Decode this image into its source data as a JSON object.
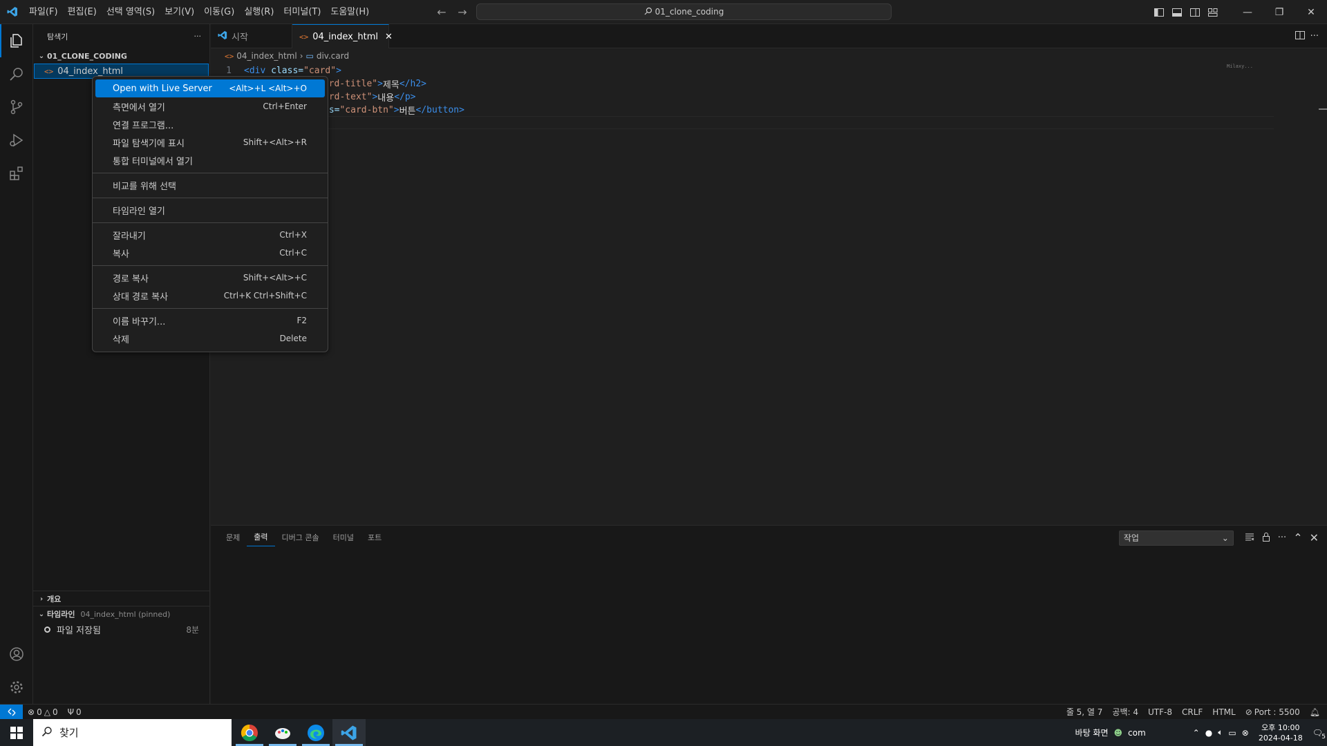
{
  "titlebar": {
    "menus": [
      "파일(F)",
      "편집(E)",
      "선택 영역(S)",
      "보기(V)",
      "이동(G)",
      "실행(R)",
      "터미널(T)",
      "도움말(H)"
    ],
    "search_text": "01_clone_coding"
  },
  "sidebar": {
    "header": "탐색기",
    "more": "···",
    "folder": "01_CLONE_CODING",
    "file": "04_index_html",
    "outline_title": "개요",
    "timeline_title": "타임라인",
    "timeline_sub": "04_index_html (pinned)",
    "timeline_entry": "파일 저장됨",
    "timeline_age": "8분"
  },
  "tabs": [
    {
      "label": "시작",
      "active": false
    },
    {
      "label": "04_index_html",
      "active": true
    }
  ],
  "breadcrumb": {
    "file": "04_index_html",
    "symbol": "div.card"
  },
  "editor": {
    "line1_num": "1",
    "line1": {
      "open": "<div",
      "attr": " class=",
      "str": "\"card\"",
      "close": ">"
    },
    "line2": {
      "str": "card-title\"",
      "close": ">",
      "txt": "제목",
      "end": "</h2>"
    },
    "line3": {
      "str": "ard-text\"",
      "close": ">",
      "txt": "내용",
      "end": "</p>"
    },
    "line4": {
      "attr": "ss=",
      "str": "\"card-btn\"",
      "close": ">",
      "txt": "버튼",
      "end": "</button>"
    },
    "minimap_text": "Milaxy..."
  },
  "context_menu": {
    "items": [
      {
        "label": "Open with Live Server",
        "kb": "<Alt>+L <Alt>+O",
        "highlight": true
      },
      {
        "label": "측면에서 열기",
        "kb": "Ctrl+Enter"
      },
      {
        "label": "연결 프로그램...",
        "kb": ""
      },
      {
        "label": "파일 탐색기에 표시",
        "kb": "Shift+<Alt>+R"
      },
      {
        "label": "통합 터미널에서 열기",
        "kb": ""
      },
      {
        "sep": true
      },
      {
        "label": "비교를 위해 선택",
        "kb": ""
      },
      {
        "sep": true
      },
      {
        "label": "타임라인 열기",
        "kb": ""
      },
      {
        "sep": true
      },
      {
        "label": "잘라내기",
        "kb": "Ctrl+X"
      },
      {
        "label": "복사",
        "kb": "Ctrl+C"
      },
      {
        "sep": true
      },
      {
        "label": "경로 복사",
        "kb": "Shift+<Alt>+C"
      },
      {
        "label": "상대 경로 복사",
        "kb": "Ctrl+K Ctrl+Shift+C"
      },
      {
        "sep": true
      },
      {
        "label": "이름 바꾸기...",
        "kb": "F2"
      },
      {
        "label": "삭제",
        "kb": "Delete"
      }
    ]
  },
  "panel": {
    "tabs": [
      "문제",
      "출력",
      "디버그 콘솔",
      "터미널",
      "포트"
    ],
    "active_tab": "출력",
    "output_channel": "작업"
  },
  "statusbar": {
    "errors": "0",
    "warnings": "0",
    "ports": "0",
    "position": "줄 5, 열 7",
    "spaces": "공백: 4",
    "encoding": "UTF-8",
    "eol": "CRLF",
    "language": "HTML",
    "live_port": "Port : 5500"
  },
  "taskbar": {
    "search": "찾기",
    "desktop": "바탕 화면",
    "user": "com",
    "time": "오후 10:00",
    "date": "2024-04-18",
    "notifications": "5"
  },
  "colors": {
    "accent": "#0078d4",
    "highlight": "#0078d4",
    "html_icon": "#e37933"
  }
}
